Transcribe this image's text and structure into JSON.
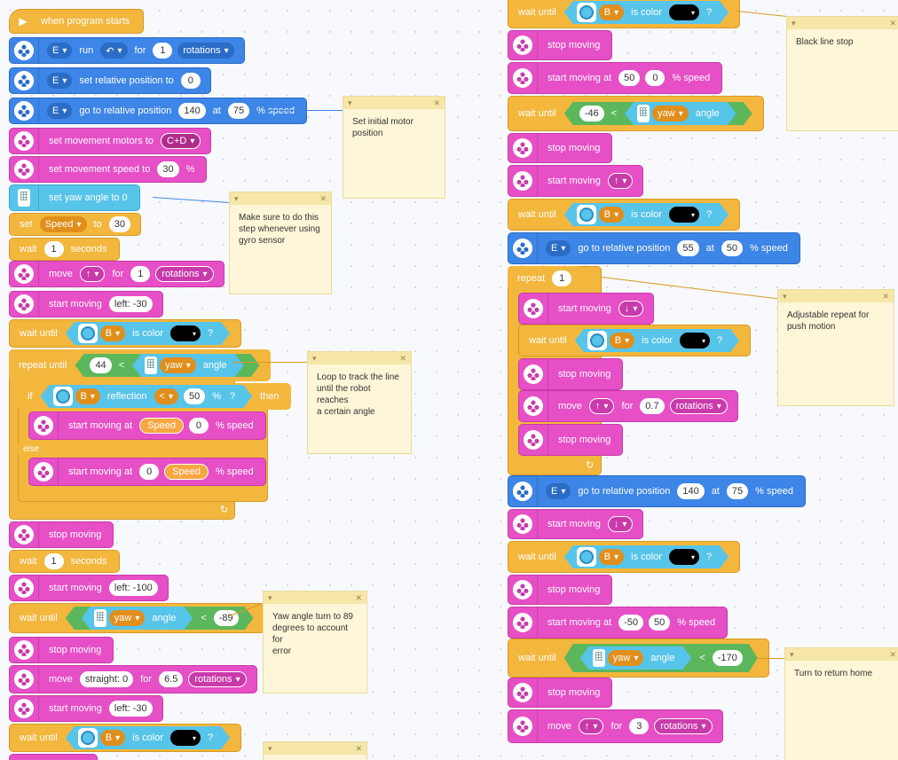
{
  "left": {
    "hat": "when program starts",
    "b1": [
      "E",
      "run",
      "for",
      "1",
      "rotations"
    ],
    "b2": [
      "E",
      "set relative position to",
      "0"
    ],
    "b3": [
      "E",
      "go to relative position",
      "140",
      "at",
      "75",
      "% speed"
    ],
    "b4": [
      "set movement motors to",
      "C+D"
    ],
    "b5": [
      "set movement speed to",
      "30",
      "%"
    ],
    "b6": "set yaw angle to 0",
    "b7": [
      "set",
      "Speed",
      "to",
      "30"
    ],
    "b8": [
      "wait",
      "1",
      "seconds"
    ],
    "b9": [
      "move",
      "↑",
      "for",
      "1",
      "rotations"
    ],
    "b10": [
      "start moving",
      "left: -30"
    ],
    "b11": [
      "wait until",
      "B",
      "is color",
      "?"
    ],
    "b12": [
      "repeat until",
      "44",
      "<",
      "yaw",
      "angle"
    ],
    "b13": [
      "if",
      "B",
      "reflection",
      "<",
      "50",
      "%",
      "?",
      "then"
    ],
    "b14": [
      "start moving at",
      "Speed",
      "0",
      "% speed"
    ],
    "b15": "else",
    "b16": [
      "start moving at",
      "0",
      "Speed",
      "% speed"
    ],
    "b17": "stop moving",
    "b18": [
      "wait",
      "1",
      "seconds"
    ],
    "b19": [
      "start moving",
      "left: -100"
    ],
    "b20": [
      "wait until",
      "yaw",
      "angle",
      "<",
      "-89"
    ],
    "b21": "stop moving",
    "b22": [
      "move",
      "straight: 0",
      "for",
      "6.5",
      "rotations"
    ],
    "b23": [
      "start moving",
      "left: -30"
    ],
    "b24": [
      "wait until",
      "B",
      "is color",
      "?"
    ]
  },
  "right": {
    "r1": [
      "wait until",
      "B",
      "is color",
      "?"
    ],
    "r2": "stop moving",
    "r3": [
      "start moving at",
      "50",
      "0",
      "% speed"
    ],
    "r4": [
      "wait until",
      "-46",
      "<",
      "yaw",
      "angle"
    ],
    "r5": "stop moving",
    "r6": [
      "start moving",
      "↑"
    ],
    "r7": [
      "wait until",
      "B",
      "is color",
      "?"
    ],
    "r8": [
      "E",
      "go to relative position",
      "55",
      "at",
      "50",
      "% speed"
    ],
    "r9": [
      "repeat",
      "1"
    ],
    "r10": [
      "start moving",
      "↓"
    ],
    "r11": [
      "wait until",
      "B",
      "is color",
      "?"
    ],
    "r12": "stop moving",
    "r13": [
      "move",
      "↑",
      "for",
      "0.7",
      "rotations"
    ],
    "r14": "stop moving",
    "r15": [
      "E",
      "go to relative position",
      "140",
      "at",
      "75",
      "% speed"
    ],
    "r16": [
      "start moving",
      "↓"
    ],
    "r17": [
      "wait until",
      "B",
      "is color",
      "?"
    ],
    "r18": "stop moving",
    "r19": [
      "start moving at",
      "-50",
      "50",
      "% speed"
    ],
    "r20": [
      "wait until",
      "yaw",
      "angle",
      "<",
      "-170"
    ],
    "r21": "stop moving",
    "r22": [
      "move",
      "↑",
      "for",
      "3",
      "rotations"
    ]
  },
  "notes": {
    "n1": "Set initial motor\nposition",
    "n2": "Make sure to do this\nstep whenever using\ngyro sensor",
    "n3": "Loop to track the line\nuntil the robot reaches\na certain angle",
    "n4": "Yaw angle turn to 89\ndegrees to account for\nerror",
    "n5": "Black line stop",
    "n6": "Adjustable repeat for\npush motion",
    "n7": "Turn to return home"
  },
  "colors": {
    "motor": "#3d85e6",
    "movement": "#e64fc6",
    "control": "#f3b73d",
    "sensor": "#57c4ea",
    "operator": "#5cb75c"
  }
}
